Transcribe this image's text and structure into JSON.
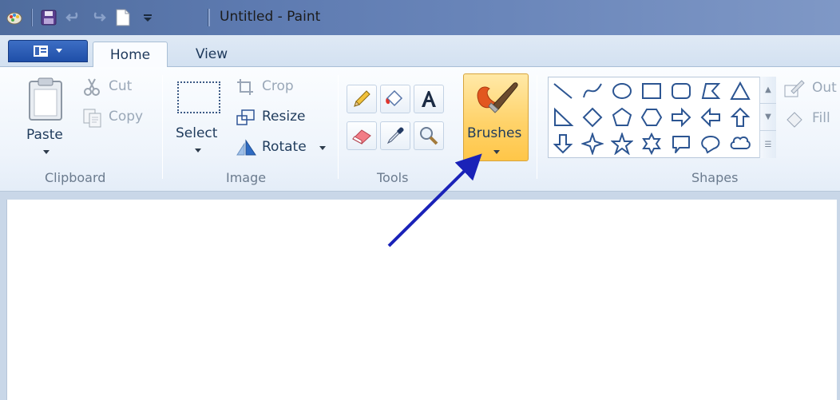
{
  "window": {
    "title": "Untitled - Paint"
  },
  "tabs": {
    "home": "Home",
    "view": "View"
  },
  "clipboard": {
    "paste": "Paste",
    "cut": "Cut",
    "copy": "Copy",
    "group": "Clipboard"
  },
  "image": {
    "select": "Select",
    "crop": "Crop",
    "resize": "Resize",
    "rotate": "Rotate",
    "group": "Image"
  },
  "tools": {
    "group": "Tools",
    "items": [
      "pencil-icon",
      "fill-icon",
      "text-icon",
      "eraser-icon",
      "color-picker-icon",
      "magnifier-icon"
    ]
  },
  "brushes": {
    "label": "Brushes"
  },
  "shapes": {
    "group": "Shapes",
    "outline": "Out",
    "fill": "Fill",
    "items": [
      "line",
      "curve",
      "oval",
      "rectangle",
      "rounded-rectangle",
      "polygon",
      "triangle",
      "right-triangle",
      "diamond",
      "pentagon",
      "hexagon",
      "right-arrow",
      "left-arrow",
      "up-arrow",
      "down-arrow",
      "four-point-star",
      "five-point-star",
      "six-point-star",
      "rounded-callout",
      "oval-callout",
      "cloud-callout"
    ]
  },
  "colors": {
    "accent_arrow": "#1a22b8",
    "brushes_highlight": "#ffd36b"
  }
}
